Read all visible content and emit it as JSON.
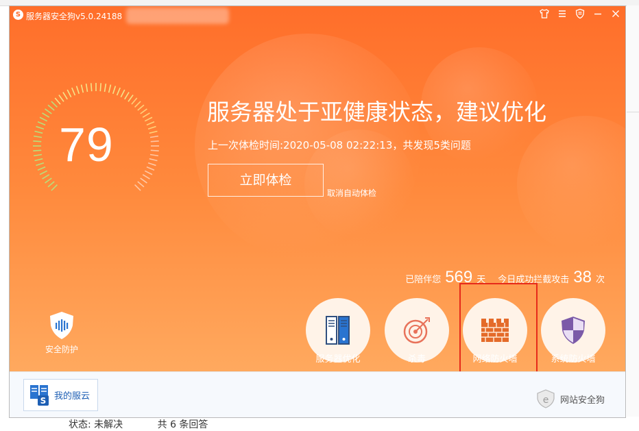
{
  "window": {
    "title": "服务器安全狗v5.0.24188",
    "titlebar_icons": [
      "shirt-icon",
      "menu-icon",
      "shield-icon",
      "minimize-icon",
      "close-icon"
    ]
  },
  "health": {
    "score": "79",
    "headline": "服务器处于亚健康状态，建议优化",
    "last_check": "上一次体检时间:2020-05-08 02:22:13，共发现5类问题",
    "check_button": "立即体检",
    "cancel_auto": "取消自动体检"
  },
  "stats": {
    "accompany_label": "已陪伴您",
    "accompany_days": "569",
    "days_unit": "天",
    "blocked_label": "今日成功拦截攻击",
    "blocked_count": "38",
    "blocked_unit": "次"
  },
  "protection": {
    "label": "安全防护"
  },
  "features": [
    {
      "label": "服务器优化",
      "icon": "server-optimize-icon"
    },
    {
      "label": "杀毒",
      "icon": "antivirus-target-icon"
    },
    {
      "label": "网络防火墙",
      "icon": "firewall-brick-icon"
    },
    {
      "label": "系统防火墙",
      "icon": "system-shield-icon"
    }
  ],
  "bottom": {
    "my_cloud": "我的服云",
    "site_dog": "网站安全狗"
  },
  "page_footer": {
    "status": "状态: 未解决",
    "answers": "共 6 条回答"
  },
  "colors": {
    "accent": "#ff6e2a",
    "highlight_box": "#e62a1a",
    "link_blue": "#1e5fb4"
  }
}
